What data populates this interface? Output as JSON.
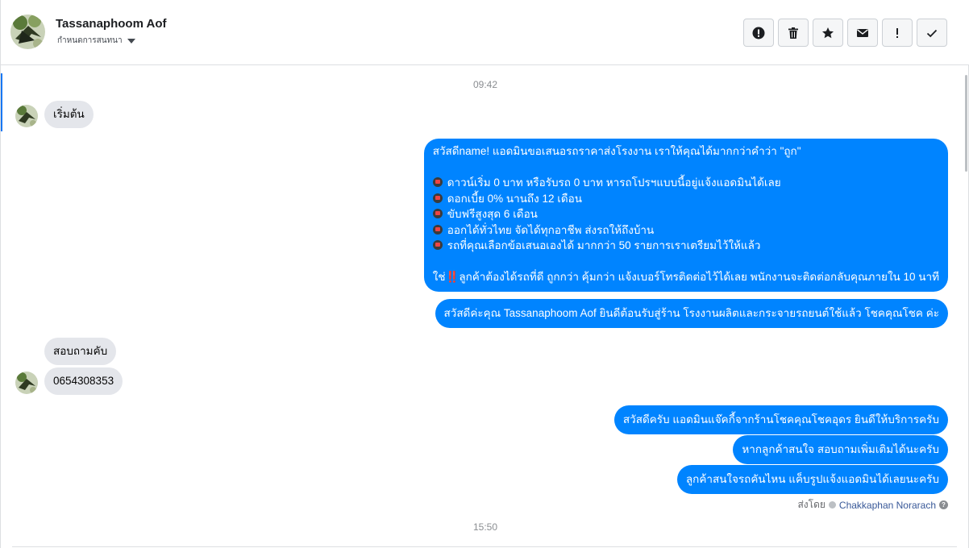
{
  "header": {
    "contact_name": "Tassanaphoom Aof",
    "assign_label": "กำหนดการสนทนา",
    "toolbar_icons": [
      "alert-circle-icon",
      "trash-icon",
      "star-icon",
      "envelope-icon",
      "exclamation-icon",
      "check-icon"
    ]
  },
  "conversation": {
    "timestamps": [
      "09:42",
      "15:50"
    ],
    "messages": {
      "m1": "เริ่มต้น",
      "m2": {
        "intro": "สวัสดีname! แอดมินขอเสนอรถราคาส่งโรงงาน เราให้คุณได้มากกว่าคำว่า \"ถูก\"",
        "bullets": [
          "ดาวน์เริ่ม 0 บาท หรือรับรถ 0 บาท หารถโปรฯแบบนี้อยู่แจ้งแอดมินได้เลย",
          "ดอกเบี้ย 0% นานถึง 12 เดือน",
          "ขับฟรีสูงสุด 6 เดือน",
          "ออกได้ทั่วไทย จัดได้ทุกอาชีพ ส่งรถให้ถึงบ้าน",
          "รถที่คุณเลือกข้อเสนอเองได้ มากกว่า 50 รายการเราเตรียมไว้ให้แล้ว"
        ],
        "outro_prefix": "ใช่",
        "outro_mark": "‼️",
        "outro_rest": "ลูกค้าต้องได้รถที่ดี ถูกกว่า คุ้มกว่า แจ้งเบอร์โทรติดต่อไว้ได้เลย พนักงานจะติดต่อกลับคุณภายใน 10 นาที"
      },
      "m3": "สวัสดีค่ะคุณ Tassanaphoom Aof ยินดีต้อนรับสู่ร้าน โรงงานผลิตและกระจายรถยนต์ใช้แล้ว โชคคุณโชค ค่ะ",
      "m4": "สอบถามคับ",
      "m5": "0654308353",
      "m6": "สวัสดีครับ แอดมินแจ๊คกี้จากร้านโชคคุณโชคอุดร ยินดีให้บริการครับ",
      "m7": "หากลูกค้าสนใจ สอบถามเพิ่มเติมได้นะครับ",
      "m8": "ลูกค้าสนใจรถคันไหน แค็บรูปแจ้งแอดมินได้เลยนะครับ"
    },
    "sent_by_label": "ส่งโดย",
    "sent_by_agent": "Chakkaphan Norarach"
  }
}
